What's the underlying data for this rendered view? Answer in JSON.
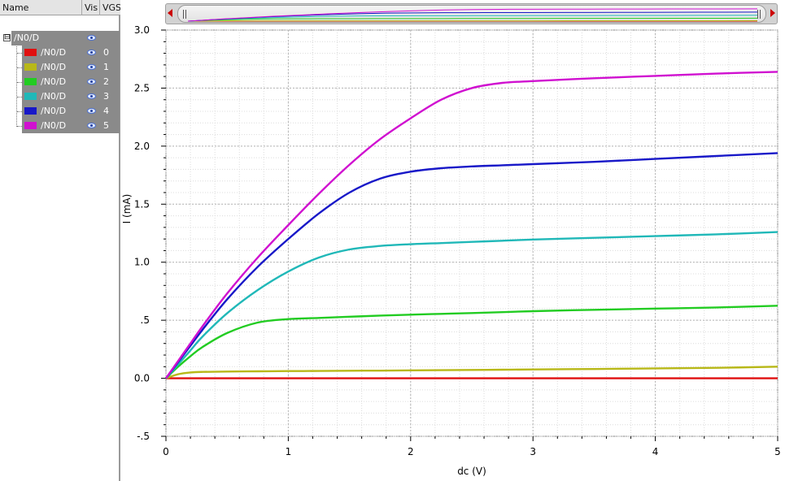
{
  "left_panel": {
    "headers": {
      "name": "Name",
      "vis": "Vis",
      "vgs": "VGS"
    },
    "parent": {
      "label": "/N0/D",
      "expander": "⊟"
    },
    "signals": [
      {
        "label": "/N0/D",
        "vgs": "0",
        "color": "#e01010"
      },
      {
        "label": "/N0/D",
        "vgs": "1",
        "color": "#b8b818"
      },
      {
        "label": "/N0/D",
        "vgs": "2",
        "color": "#22cc22"
      },
      {
        "label": "/N0/D",
        "vgs": "3",
        "color": "#20b8b8"
      },
      {
        "label": "/N0/D",
        "vgs": "4",
        "color": "#1818c8"
      },
      {
        "label": "/N0/D",
        "vgs": "5",
        "color": "#d010d0"
      }
    ]
  },
  "chart_data": {
    "type": "line",
    "xlabel": "dc (V)",
    "ylabel": "I (mA)",
    "xlim": [
      0,
      5
    ],
    "ylim": [
      -0.5,
      3.0
    ],
    "xticks": [
      "0",
      "1",
      "2",
      "3",
      "4",
      "5"
    ],
    "yticks": [
      "-.5",
      "0.0",
      ".5",
      "1.0",
      "1.5",
      "2.0",
      "2.5",
      "3.0"
    ],
    "grid": true,
    "x": [
      0,
      0.1,
      0.2,
      0.3,
      0.5,
      0.75,
      1.0,
      1.25,
      1.5,
      1.75,
      2.0,
      2.25,
      2.5,
      2.75,
      3.0,
      3.5,
      4.0,
      4.5,
      5.0
    ],
    "series": [
      {
        "name": "0",
        "color": "#e01010",
        "values": [
          0,
          0,
          0,
          0,
          0,
          0,
          0,
          0,
          0,
          0,
          0,
          0,
          0,
          0,
          0,
          0,
          0,
          0,
          0
        ]
      },
      {
        "name": "1",
        "color": "#b8b818",
        "values": [
          0,
          0.035,
          0.05,
          0.055,
          0.058,
          0.06,
          0.062,
          0.063,
          0.065,
          0.066,
          0.068,
          0.07,
          0.072,
          0.074,
          0.076,
          0.08,
          0.085,
          0.09,
          0.1
        ]
      },
      {
        "name": "2",
        "color": "#22cc22",
        "values": [
          0,
          0.1,
          0.19,
          0.27,
          0.39,
          0.48,
          0.51,
          0.52,
          0.53,
          0.54,
          0.548,
          0.555,
          0.562,
          0.57,
          0.578,
          0.59,
          0.6,
          0.61,
          0.625
        ]
      },
      {
        "name": "3",
        "color": "#20b8b8",
        "values": [
          0,
          0.12,
          0.24,
          0.36,
          0.56,
          0.76,
          0.92,
          1.04,
          1.11,
          1.14,
          1.155,
          1.165,
          1.175,
          1.185,
          1.195,
          1.21,
          1.225,
          1.24,
          1.26
        ]
      },
      {
        "name": "4",
        "color": "#1818c8",
        "values": [
          0,
          0.14,
          0.28,
          0.42,
          0.68,
          0.96,
          1.2,
          1.42,
          1.6,
          1.72,
          1.78,
          1.81,
          1.825,
          1.835,
          1.845,
          1.865,
          1.89,
          1.915,
          1.94
        ]
      },
      {
        "name": "5",
        "color": "#d010d0",
        "values": [
          0,
          0.15,
          0.3,
          0.45,
          0.73,
          1.04,
          1.32,
          1.59,
          1.84,
          2.06,
          2.24,
          2.4,
          2.5,
          2.545,
          2.56,
          2.585,
          2.605,
          2.625,
          2.64
        ]
      }
    ]
  }
}
